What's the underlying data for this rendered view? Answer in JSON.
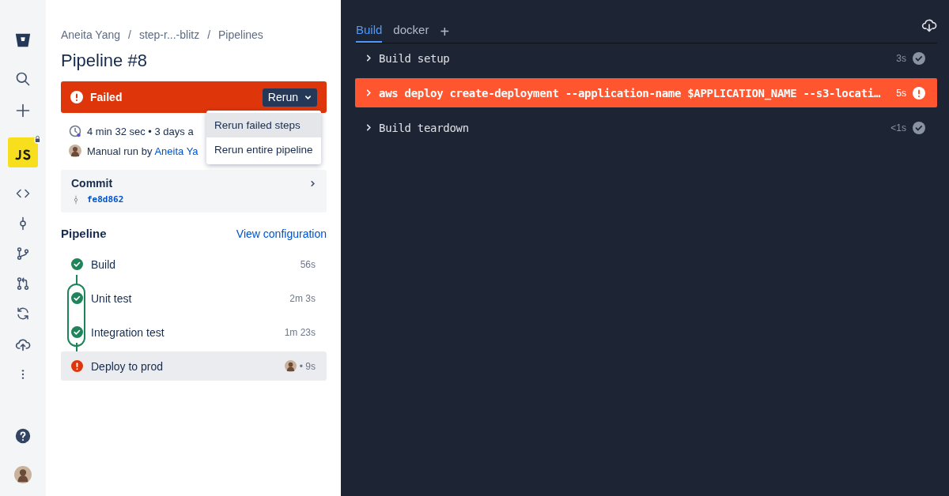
{
  "breadcrumbs": [
    {
      "label": "Aneita Yang"
    },
    {
      "separator": "/",
      "label": "step-r...-blitz"
    },
    {
      "separator": "/",
      "label": "Pipelines"
    }
  ],
  "title": "Pipeline #8",
  "status": {
    "kind": "failed",
    "label": "Failed",
    "button": "Rerun"
  },
  "rerun_menu": [
    {
      "label": "Rerun failed steps",
      "selected": true
    },
    {
      "label": "Rerun entire pipeline",
      "selected": false
    }
  ],
  "meta": {
    "duration": "4 min 32 sec • 3 days a",
    "run_by": "Manual run by",
    "author": "Aneita Ya"
  },
  "commit": {
    "label": "Commit",
    "hash": "fe8d862"
  },
  "pipeline": {
    "heading": "Pipeline",
    "link": "View configuration",
    "stages": [
      {
        "steps": [
          {
            "name": "Build",
            "duration": "56s",
            "kind": "success",
            "selected": false,
            "avatar": false
          }
        ]
      },
      {
        "steps": [
          {
            "name": "Unit test",
            "duration": "2m 3s",
            "kind": "success",
            "selected": false,
            "avatar": false
          },
          {
            "name": "Integration test",
            "duration": "1m 23s",
            "kind": "success",
            "selected": false,
            "avatar": false
          }
        ]
      },
      {
        "steps": [
          {
            "name": "Deploy to prod",
            "duration": "• 9s",
            "kind": "failed",
            "selected": true,
            "avatar": true
          }
        ]
      }
    ]
  },
  "log": {
    "tabs": [
      {
        "label": "Build",
        "selected": true
      },
      {
        "label": "docker",
        "selected": false
      }
    ],
    "add": "+",
    "rows": [
      {
        "text": "Build setup",
        "duration": "3s",
        "kind": "success"
      },
      {
        "text": "aws deploy create-deployment --application-name $APPLICATION_NAME --s3-locati…",
        "duration": "5s",
        "kind": "failed"
      },
      {
        "text": "Build teardown",
        "duration": "<1s",
        "kind": "success"
      }
    ]
  }
}
